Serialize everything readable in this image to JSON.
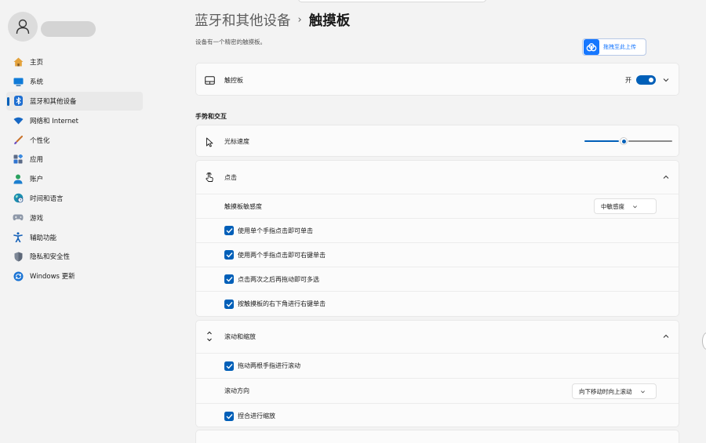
{
  "sidebar": {
    "items": [
      {
        "label": "主页",
        "icon": "home-icon"
      },
      {
        "label": "系统",
        "icon": "system-monitor-icon"
      },
      {
        "label": "蓝牙和其他设备",
        "icon": "bluetooth-icon",
        "active": true
      },
      {
        "label": "网络和 Internet",
        "icon": "wifi-icon"
      },
      {
        "label": "个性化",
        "icon": "brush-icon"
      },
      {
        "label": "应用",
        "icon": "apps-icon"
      },
      {
        "label": "账户",
        "icon": "account-icon"
      },
      {
        "label": "时间和语言",
        "icon": "globe-clock-icon"
      },
      {
        "label": "游戏",
        "icon": "gamepad-icon"
      },
      {
        "label": "辅助功能",
        "icon": "accessibility-icon"
      },
      {
        "label": "隐私和安全性",
        "icon": "shield-icon"
      },
      {
        "label": "Windows 更新",
        "icon": "update-icon"
      }
    ]
  },
  "header": {
    "parent": "蓝牙和其他设备",
    "separator": "›",
    "current": "触摸板",
    "subtitle": "设备有一个精密的触摸板。",
    "upload_label": "拖拽至此上传"
  },
  "touchpad_card": {
    "label": "触控板",
    "toggle_state": "开",
    "toggle_on": true
  },
  "gestures_section": {
    "title": "手势和交互"
  },
  "cursor_speed": {
    "label": "光标速度",
    "slider_value": 0.45
  },
  "taps": {
    "title": "点击",
    "sensitivity_label": "触摸板敏感度",
    "sensitivity_value": "中敏感度",
    "options": [
      {
        "label": "使用单个手指点击即可单击",
        "checked": true
      },
      {
        "label": "使用两个手指点击即可右键单击",
        "checked": true
      },
      {
        "label": "点击两次之后再拖动即可多选",
        "checked": true
      },
      {
        "label": "按触摸板的右下角进行右键单击",
        "checked": true
      }
    ]
  },
  "scroll_zoom": {
    "title": "滚动和缩放",
    "drag_scroll_label": "拖动两根手指进行滚动",
    "direction_label": "滚动方向",
    "direction_value": "向下移动时向上滚动",
    "pinch_label": "捏合进行缩放"
  },
  "colors": {
    "accent": "#005fb8",
    "upload_blue": "#1677ff"
  }
}
